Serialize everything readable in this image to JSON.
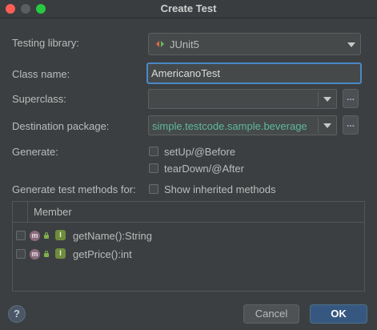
{
  "window": {
    "title": "Create Test"
  },
  "form": {
    "testing_library_label": "Testing library:",
    "testing_library_value": "JUnit5",
    "class_name_label": "Class name:",
    "class_name_value": "AmericanoTest",
    "superclass_label": "Superclass:",
    "superclass_value": "",
    "destination_label": "Destination package:",
    "destination_value": "simple.testcode.sample.beverage",
    "generate_label": "Generate:",
    "generate_options": [
      {
        "label": "setUp/@Before",
        "checked": false
      },
      {
        "label": "tearDown/@After",
        "checked": false
      }
    ],
    "methods_label": "Generate test methods for:",
    "show_inherited_label": "Show inherited methods",
    "browse_label": "..."
  },
  "table": {
    "header": "Member",
    "rows": [
      {
        "method": "getName():String",
        "checked": false,
        "icon_text": "m",
        "badge": "I"
      },
      {
        "method": "getPrice():int",
        "checked": false,
        "icon_text": "m",
        "badge": "I"
      }
    ]
  },
  "buttons": {
    "help": "?",
    "cancel": "Cancel",
    "ok": "OK"
  },
  "colors": {
    "background": "#3c3f41",
    "focus_border": "#4a88c7",
    "package_text": "#5fb99a",
    "ok_button": "#365880"
  }
}
